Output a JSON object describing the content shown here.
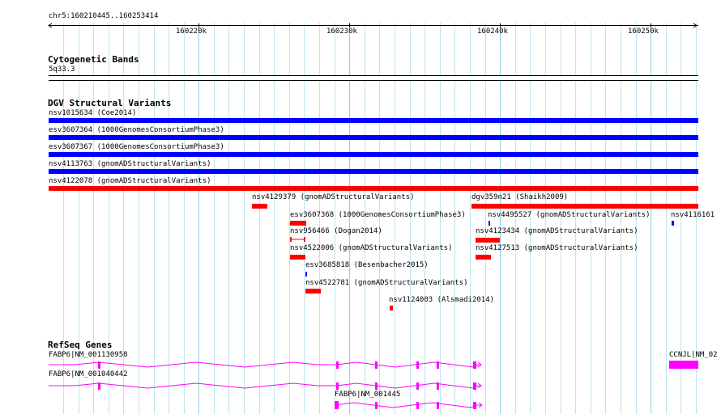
{
  "ruler": {
    "location": "chr5:160210445..160253414",
    "ticks": [
      "160220k",
      "160230k",
      "160240k",
      "160250k"
    ]
  },
  "cytobands": {
    "title": "Cytogenetic Bands",
    "band": "5q33.3"
  },
  "dgv": {
    "title": "DGV Structural Variants",
    "variants": [
      {
        "label": "nsv1015634 (Coe2014)",
        "color": "#0000ff"
      },
      {
        "label": "esv3607364 (1000GenomesConsortiumPhase3)",
        "color": "#0000ff"
      },
      {
        "label": "esv3607367 (1000GenomesConsortiumPhase3)",
        "color": "#0000ff"
      },
      {
        "label": "nsv4113763 (gnomADStructuralVariants)",
        "color": "#0000ff"
      },
      {
        "label": "nsv4122078 (gnomADStructuralVariants)",
        "color": "#ff0000"
      },
      {
        "label": "nsv4129379 (gnomADStructuralVariants)",
        "color": "#ff0000"
      },
      {
        "label": "dgv359n21 (Shaikh2009)",
        "color": "#ff0000"
      },
      {
        "label": "esv3607368 (1000GenomesConsortiumPhase3)",
        "color": "#ff0000"
      },
      {
        "label": "nsv4495527 (gnomADStructuralVariants)",
        "color": "#0000ff"
      },
      {
        "label": "nsv4116161",
        "color": "#0000ff"
      },
      {
        "label": "nsv956466 (Dogan2014)",
        "color": "#ff0000"
      },
      {
        "label": "nsv4123434 (gnomADStructuralVariants)",
        "color": "#ff0000"
      },
      {
        "label": "nsv4522006 (gnomADStructuralVariants)",
        "color": "#ff0000"
      },
      {
        "label": "nsv4127513 (gnomADStructuralVariants)",
        "color": "#ff0000"
      },
      {
        "label": "esv3685818 (Besenbacher2015)",
        "color": "#0000ff"
      },
      {
        "label": "nsv4522781 (gnomADStructuralVariants)",
        "color": "#ff0000"
      },
      {
        "label": "nsv1124003 (Alsmadi2014)",
        "color": "#ff0000"
      }
    ]
  },
  "refseq": {
    "title": "RefSeq Genes",
    "color": "#ff00ff",
    "genes": [
      {
        "label": "FABP6|NM_001130958"
      },
      {
        "label": "FABP6|NM_001040442"
      },
      {
        "label": "FABP6|NM_001445"
      },
      {
        "label": "CCNJL|NM_02"
      }
    ]
  }
}
